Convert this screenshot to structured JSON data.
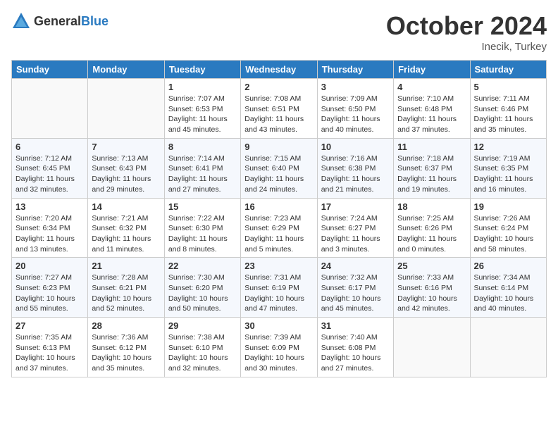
{
  "header": {
    "logo_general": "General",
    "logo_blue": "Blue",
    "month_title": "October 2024",
    "location": "Inecik, Turkey"
  },
  "weekdays": [
    "Sunday",
    "Monday",
    "Tuesday",
    "Wednesday",
    "Thursday",
    "Friday",
    "Saturday"
  ],
  "weeks": [
    [
      {
        "day": "",
        "info": ""
      },
      {
        "day": "",
        "info": ""
      },
      {
        "day": "1",
        "sunrise": "Sunrise: 7:07 AM",
        "sunset": "Sunset: 6:53 PM",
        "daylight": "Daylight: 11 hours and 45 minutes."
      },
      {
        "day": "2",
        "sunrise": "Sunrise: 7:08 AM",
        "sunset": "Sunset: 6:51 PM",
        "daylight": "Daylight: 11 hours and 43 minutes."
      },
      {
        "day": "3",
        "sunrise": "Sunrise: 7:09 AM",
        "sunset": "Sunset: 6:50 PM",
        "daylight": "Daylight: 11 hours and 40 minutes."
      },
      {
        "day": "4",
        "sunrise": "Sunrise: 7:10 AM",
        "sunset": "Sunset: 6:48 PM",
        "daylight": "Daylight: 11 hours and 37 minutes."
      },
      {
        "day": "5",
        "sunrise": "Sunrise: 7:11 AM",
        "sunset": "Sunset: 6:46 PM",
        "daylight": "Daylight: 11 hours and 35 minutes."
      }
    ],
    [
      {
        "day": "6",
        "sunrise": "Sunrise: 7:12 AM",
        "sunset": "Sunset: 6:45 PM",
        "daylight": "Daylight: 11 hours and 32 minutes."
      },
      {
        "day": "7",
        "sunrise": "Sunrise: 7:13 AM",
        "sunset": "Sunset: 6:43 PM",
        "daylight": "Daylight: 11 hours and 29 minutes."
      },
      {
        "day": "8",
        "sunrise": "Sunrise: 7:14 AM",
        "sunset": "Sunset: 6:41 PM",
        "daylight": "Daylight: 11 hours and 27 minutes."
      },
      {
        "day": "9",
        "sunrise": "Sunrise: 7:15 AM",
        "sunset": "Sunset: 6:40 PM",
        "daylight": "Daylight: 11 hours and 24 minutes."
      },
      {
        "day": "10",
        "sunrise": "Sunrise: 7:16 AM",
        "sunset": "Sunset: 6:38 PM",
        "daylight": "Daylight: 11 hours and 21 minutes."
      },
      {
        "day": "11",
        "sunrise": "Sunrise: 7:18 AM",
        "sunset": "Sunset: 6:37 PM",
        "daylight": "Daylight: 11 hours and 19 minutes."
      },
      {
        "day": "12",
        "sunrise": "Sunrise: 7:19 AM",
        "sunset": "Sunset: 6:35 PM",
        "daylight": "Daylight: 11 hours and 16 minutes."
      }
    ],
    [
      {
        "day": "13",
        "sunrise": "Sunrise: 7:20 AM",
        "sunset": "Sunset: 6:34 PM",
        "daylight": "Daylight: 11 hours and 13 minutes."
      },
      {
        "day": "14",
        "sunrise": "Sunrise: 7:21 AM",
        "sunset": "Sunset: 6:32 PM",
        "daylight": "Daylight: 11 hours and 11 minutes."
      },
      {
        "day": "15",
        "sunrise": "Sunrise: 7:22 AM",
        "sunset": "Sunset: 6:30 PM",
        "daylight": "Daylight: 11 hours and 8 minutes."
      },
      {
        "day": "16",
        "sunrise": "Sunrise: 7:23 AM",
        "sunset": "Sunset: 6:29 PM",
        "daylight": "Daylight: 11 hours and 5 minutes."
      },
      {
        "day": "17",
        "sunrise": "Sunrise: 7:24 AM",
        "sunset": "Sunset: 6:27 PM",
        "daylight": "Daylight: 11 hours and 3 minutes."
      },
      {
        "day": "18",
        "sunrise": "Sunrise: 7:25 AM",
        "sunset": "Sunset: 6:26 PM",
        "daylight": "Daylight: 11 hours and 0 minutes."
      },
      {
        "day": "19",
        "sunrise": "Sunrise: 7:26 AM",
        "sunset": "Sunset: 6:24 PM",
        "daylight": "Daylight: 10 hours and 58 minutes."
      }
    ],
    [
      {
        "day": "20",
        "sunrise": "Sunrise: 7:27 AM",
        "sunset": "Sunset: 6:23 PM",
        "daylight": "Daylight: 10 hours and 55 minutes."
      },
      {
        "day": "21",
        "sunrise": "Sunrise: 7:28 AM",
        "sunset": "Sunset: 6:21 PM",
        "daylight": "Daylight: 10 hours and 52 minutes."
      },
      {
        "day": "22",
        "sunrise": "Sunrise: 7:30 AM",
        "sunset": "Sunset: 6:20 PM",
        "daylight": "Daylight: 10 hours and 50 minutes."
      },
      {
        "day": "23",
        "sunrise": "Sunrise: 7:31 AM",
        "sunset": "Sunset: 6:19 PM",
        "daylight": "Daylight: 10 hours and 47 minutes."
      },
      {
        "day": "24",
        "sunrise": "Sunrise: 7:32 AM",
        "sunset": "Sunset: 6:17 PM",
        "daylight": "Daylight: 10 hours and 45 minutes."
      },
      {
        "day": "25",
        "sunrise": "Sunrise: 7:33 AM",
        "sunset": "Sunset: 6:16 PM",
        "daylight": "Daylight: 10 hours and 42 minutes."
      },
      {
        "day": "26",
        "sunrise": "Sunrise: 7:34 AM",
        "sunset": "Sunset: 6:14 PM",
        "daylight": "Daylight: 10 hours and 40 minutes."
      }
    ],
    [
      {
        "day": "27",
        "sunrise": "Sunrise: 7:35 AM",
        "sunset": "Sunset: 6:13 PM",
        "daylight": "Daylight: 10 hours and 37 minutes."
      },
      {
        "day": "28",
        "sunrise": "Sunrise: 7:36 AM",
        "sunset": "Sunset: 6:12 PM",
        "daylight": "Daylight: 10 hours and 35 minutes."
      },
      {
        "day": "29",
        "sunrise": "Sunrise: 7:38 AM",
        "sunset": "Sunset: 6:10 PM",
        "daylight": "Daylight: 10 hours and 32 minutes."
      },
      {
        "day": "30",
        "sunrise": "Sunrise: 7:39 AM",
        "sunset": "Sunset: 6:09 PM",
        "daylight": "Daylight: 10 hours and 30 minutes."
      },
      {
        "day": "31",
        "sunrise": "Sunrise: 7:40 AM",
        "sunset": "Sunset: 6:08 PM",
        "daylight": "Daylight: 10 hours and 27 minutes."
      },
      {
        "day": "",
        "info": ""
      },
      {
        "day": "",
        "info": ""
      }
    ]
  ]
}
